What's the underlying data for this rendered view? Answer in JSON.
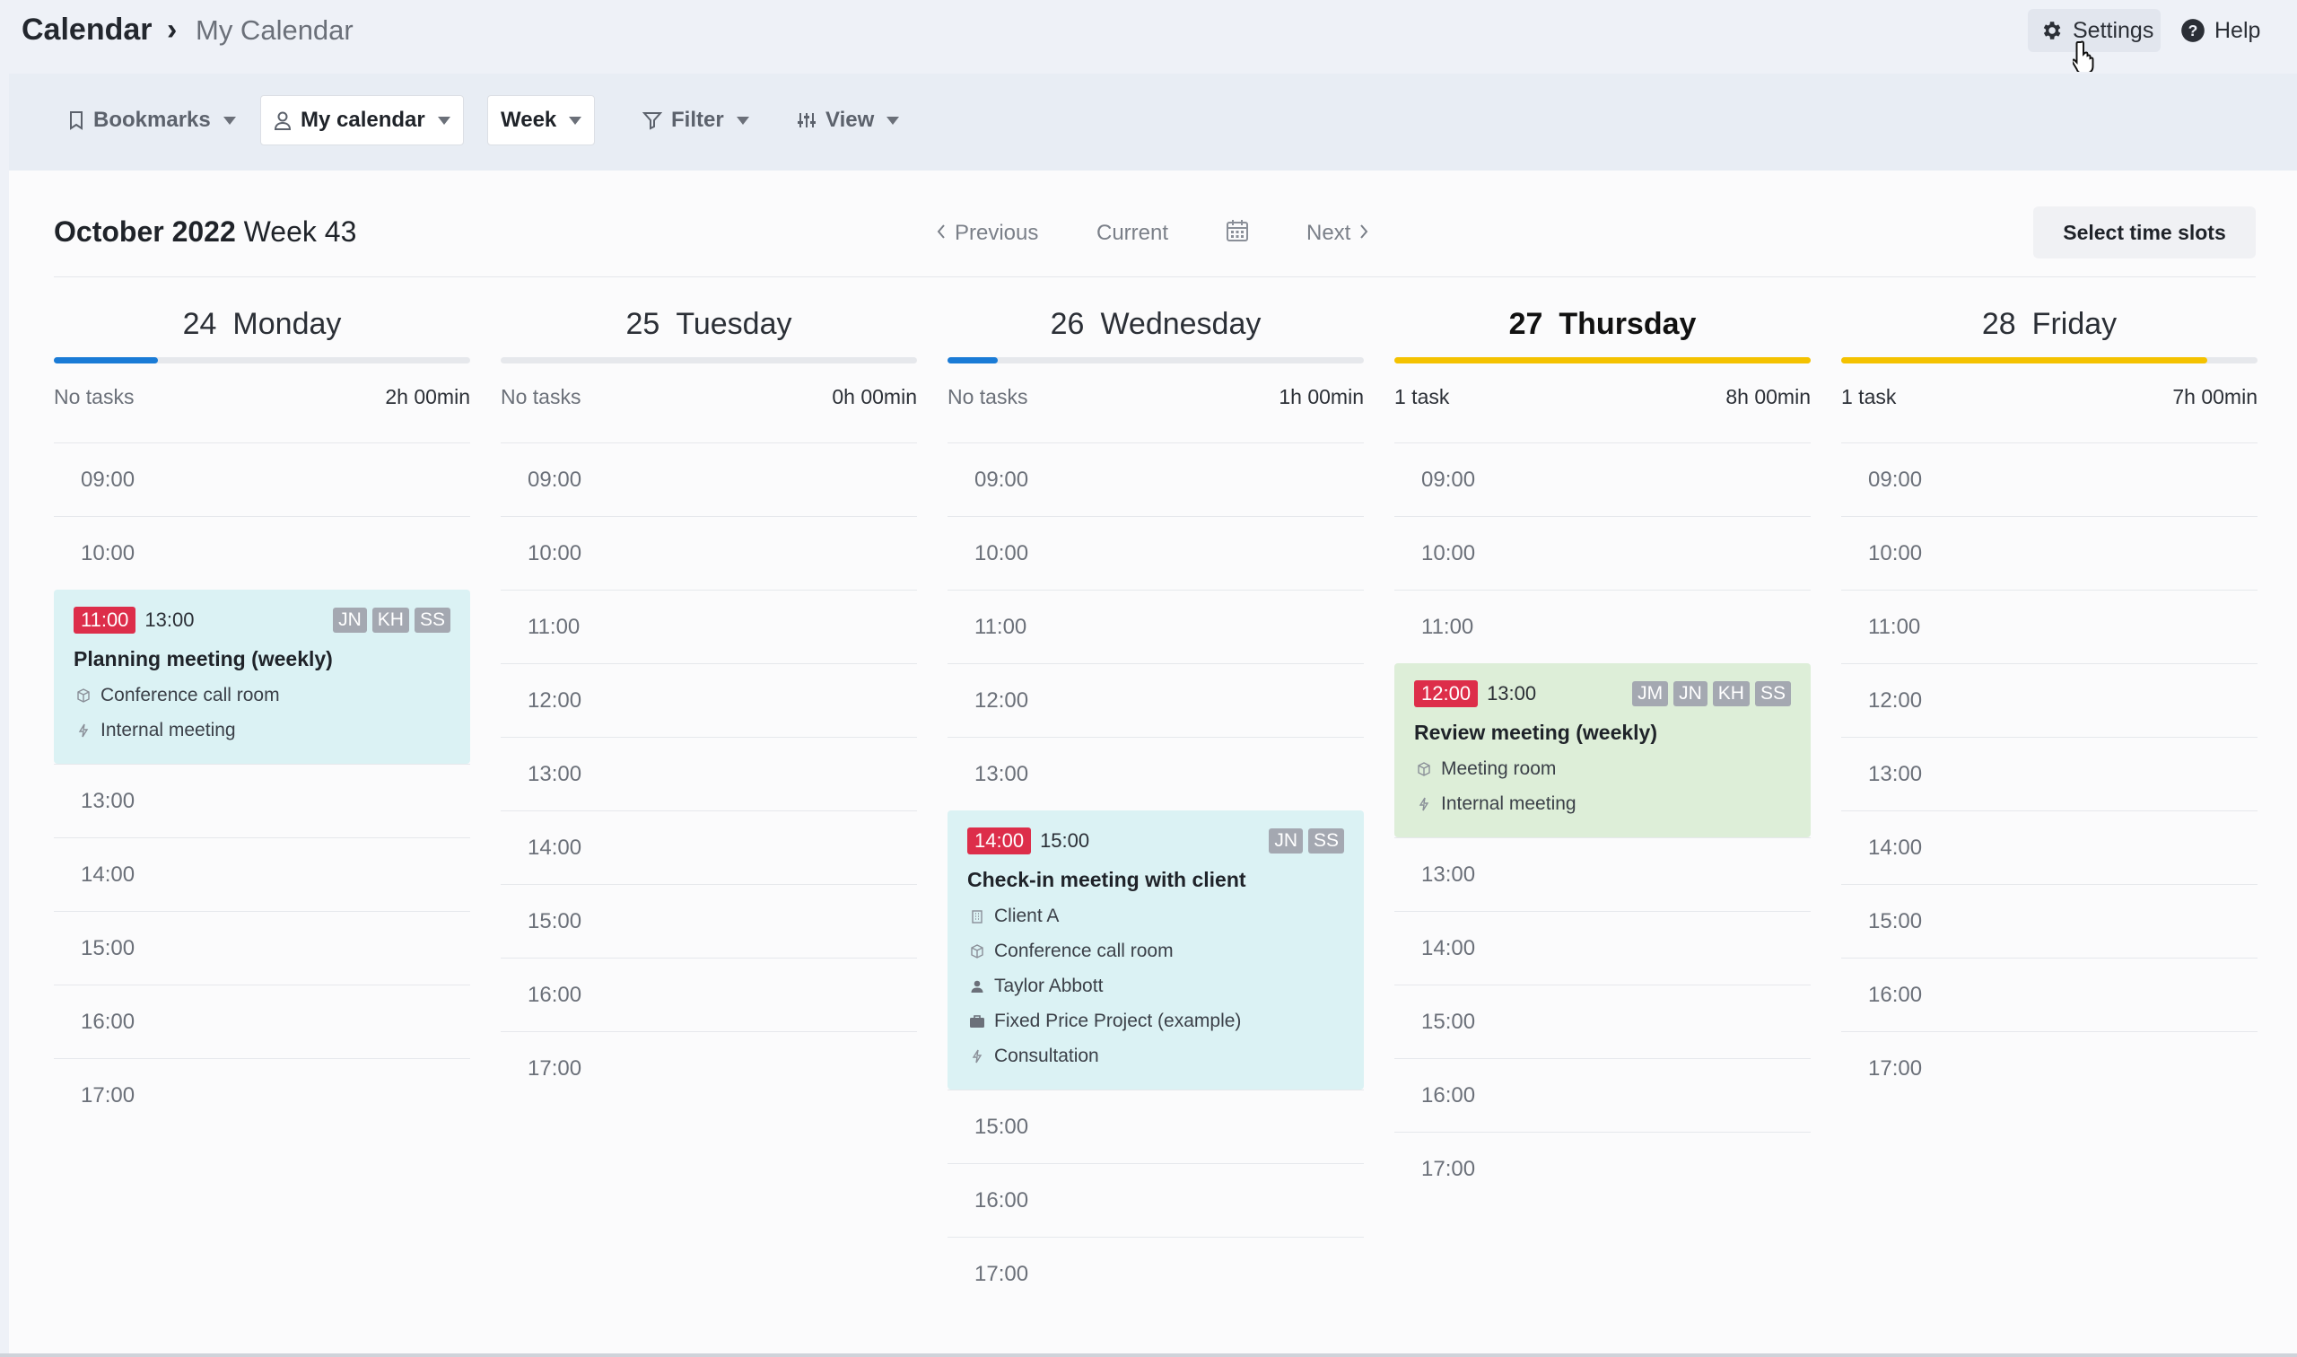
{
  "header": {
    "app_title": "Calendar",
    "separator": "›",
    "page_title": "My Calendar",
    "settings_label": "Settings",
    "help_label": "Help"
  },
  "toolbar": {
    "bookmarks_label": "Bookmarks",
    "my_calendar_label": "My calendar",
    "week_label": "Week",
    "filter_label": "Filter",
    "view_label": "View"
  },
  "week": {
    "month_year": "October 2022",
    "week_label": "Week 43",
    "previous_label": "Previous",
    "current_label": "Current",
    "next_label": "Next",
    "select_slots_label": "Select time slots"
  },
  "days": [
    {
      "num": "24",
      "name": "Monday",
      "tasks": "No tasks",
      "hours": "2h 00min",
      "progress": 0.25,
      "bar_color": "#1a7bd6",
      "slots_before": [
        "09:00",
        "10:00"
      ],
      "slots_after": [
        "13:00",
        "14:00",
        "15:00",
        "16:00",
        "17:00"
      ],
      "event": {
        "start": "11:00",
        "end": "13:00",
        "badges": [
          "JN",
          "KH",
          "SS"
        ],
        "title": "Planning meeting (weekly)",
        "lines": [
          {
            "icon": "cube-icon",
            "text": "Conference call room"
          },
          {
            "icon": "bolt-icon",
            "text": "Internal meeting"
          }
        ]
      }
    },
    {
      "num": "25",
      "name": "Tuesday",
      "tasks": "No tasks",
      "hours": "0h 00min",
      "progress": 0.0,
      "bar_color": "#1a7bd6",
      "slots": [
        "09:00",
        "10:00",
        "11:00",
        "12:00",
        "13:00",
        "14:00",
        "15:00",
        "16:00",
        "17:00"
      ]
    },
    {
      "num": "26",
      "name": "Wednesday",
      "tasks": "No tasks",
      "hours": "1h 00min",
      "progress": 0.12,
      "bar_color": "#1a7bd6",
      "slots_before": [
        "09:00",
        "10:00",
        "11:00",
        "12:00",
        "13:00"
      ],
      "slots_after": [
        "15:00",
        "16:00",
        "17:00"
      ],
      "event": {
        "start": "14:00",
        "end": "15:00",
        "badges": [
          "JN",
          "SS"
        ],
        "title": "Check-in meeting with client",
        "lines": [
          {
            "icon": "building-icon",
            "text": "Client A"
          },
          {
            "icon": "cube-icon",
            "text": "Conference call room"
          },
          {
            "icon": "person-icon",
            "text": "Taylor Abbott"
          },
          {
            "icon": "briefcase-icon",
            "text": "Fixed Price Project (example)"
          },
          {
            "icon": "bolt-icon",
            "text": "Consultation"
          }
        ]
      }
    },
    {
      "num": "27",
      "name": "Thursday",
      "tasks": "1 task",
      "hours": "8h 00min",
      "progress": 1.0,
      "bar_color": "#f4c200",
      "today": true,
      "slots_before": [
        "09:00",
        "10:00",
        "11:00"
      ],
      "slots_after": [
        "13:00",
        "14:00",
        "15:00",
        "16:00",
        "17:00"
      ],
      "event": {
        "start": "12:00",
        "end": "13:00",
        "badges": [
          "JM",
          "JN",
          "KH",
          "SS"
        ],
        "title": "Review meeting (weekly)",
        "lines": [
          {
            "icon": "cube-icon",
            "text": "Meeting room"
          },
          {
            "icon": "bolt-icon",
            "text": "Internal meeting"
          }
        ]
      }
    },
    {
      "num": "28",
      "name": "Friday",
      "tasks": "1 task",
      "hours": "7h 00min",
      "progress": 0.88,
      "bar_color": "#f4c200",
      "slots": [
        "09:00",
        "10:00",
        "11:00",
        "12:00",
        "13:00",
        "14:00",
        "15:00",
        "16:00",
        "17:00"
      ]
    }
  ]
}
